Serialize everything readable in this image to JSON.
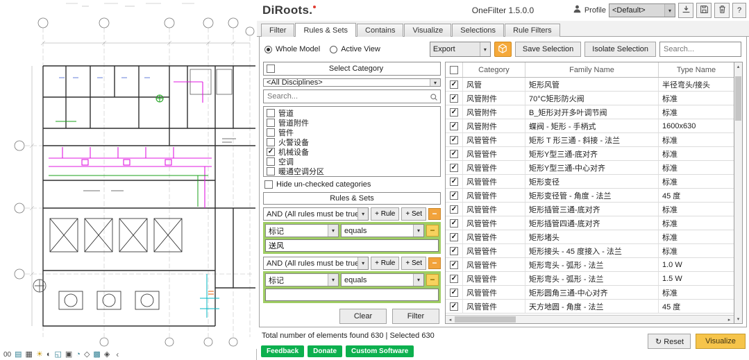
{
  "window": {
    "logo": "DiRoots.",
    "title": "OneFilter 1.5.0.0",
    "profile": {
      "label": "Profile",
      "value": "<Default>"
    },
    "help_label": "?"
  },
  "tabs": [
    {
      "label": "Filter",
      "active": false
    },
    {
      "label": "Rules & Sets",
      "active": true
    },
    {
      "label": "Contains",
      "active": false
    },
    {
      "label": "Visualize",
      "active": false
    },
    {
      "label": "Selections",
      "active": false
    },
    {
      "label": "Rule Filters",
      "active": false
    }
  ],
  "scope": {
    "whole_model": {
      "label": "Whole Model",
      "selected": true
    },
    "active_view": {
      "label": "Active View",
      "selected": false
    }
  },
  "actions": {
    "export_label": "Export",
    "save_selection_label": "Save Selection",
    "isolate_selection_label": "Isolate Selection",
    "search_placeholder": "Search..."
  },
  "category_panel": {
    "header_label": "Select Category",
    "disciplines_value": "<All Disciplines>",
    "search_placeholder": "Search...",
    "categories": [
      {
        "label": "管道",
        "checked": false
      },
      {
        "label": "管道附件",
        "checked": false
      },
      {
        "label": "管件",
        "checked": false
      },
      {
        "label": "火警设备",
        "checked": false
      },
      {
        "label": "机械设备",
        "checked": true
      },
      {
        "label": "空调",
        "checked": false
      },
      {
        "label": "暖通空调分区",
        "checked": false
      }
    ],
    "hide_unchecked_label": "Hide un-checked categories"
  },
  "rules_panel": {
    "header_label": "Rules & Sets",
    "add_rule_label": "+ Rule",
    "add_set_label": "+ Set",
    "remove_label": "−",
    "groups": [
      {
        "logic": "AND (All rules must be true)",
        "parameter": "标记",
        "operator": "equals",
        "value": "送风"
      },
      {
        "logic": "AND (All rules must be true)",
        "parameter": "标记",
        "operator": "equals",
        "value": ""
      }
    ],
    "clear_label": "Clear",
    "filter_label": "Filter"
  },
  "results_table": {
    "columns": [
      "Category",
      "Family Name",
      "Type Name"
    ],
    "rows": [
      {
        "checked": true,
        "category": "风管",
        "family": "矩形风管",
        "type": "半径弯头/接头"
      },
      {
        "checked": true,
        "category": "风管附件",
        "family": "70°C矩形防火阀",
        "type": "标准"
      },
      {
        "checked": true,
        "category": "风管附件",
        "family": "B_矩形对开多叶调节阀",
        "type": "标准"
      },
      {
        "checked": true,
        "category": "风管附件",
        "family": "蝶阀 - 矩形 - 手柄式",
        "type": "1600x630"
      },
      {
        "checked": true,
        "category": "风管管件",
        "family": "矩形 T 形三通 - 斜接 - 法兰",
        "type": "标准"
      },
      {
        "checked": true,
        "category": "风管管件",
        "family": "矩形Y型三通-底对齐",
        "type": "标准"
      },
      {
        "checked": true,
        "category": "风管管件",
        "family": "矩形Y型三通-中心对齐",
        "type": "标准"
      },
      {
        "checked": true,
        "category": "风管管件",
        "family": "矩形变径",
        "type": "标准"
      },
      {
        "checked": true,
        "category": "风管管件",
        "family": "矩形变径管 - 角度 - 法兰",
        "type": "45 度"
      },
      {
        "checked": true,
        "category": "风管管件",
        "family": "矩形插管三通-底对齐",
        "type": "标准"
      },
      {
        "checked": true,
        "category": "风管管件",
        "family": "矩形插管四通-底对齐",
        "type": "标准"
      },
      {
        "checked": true,
        "category": "风管管件",
        "family": "矩形堵头",
        "type": "标准"
      },
      {
        "checked": true,
        "category": "风管管件",
        "family": "矩形接头 - 45 度接入 - 法兰",
        "type": "标准"
      },
      {
        "checked": true,
        "category": "风管管件",
        "family": "矩形弯头 - 弧形 - 法兰",
        "type": "1.0 W"
      },
      {
        "checked": true,
        "category": "风管管件",
        "family": "矩形弯头 - 弧形 - 法兰",
        "type": "1.5 W"
      },
      {
        "checked": true,
        "category": "风管管件",
        "family": "矩形圆角三通-中心对齐",
        "type": "标准"
      },
      {
        "checked": true,
        "category": "风管管件",
        "family": "天方地圆 - 角度 - 法兰",
        "type": "45 度"
      }
    ]
  },
  "status_bar": {
    "summary": "Total number of elements found 630 | Selected 630"
  },
  "footer": {
    "reset_icon": "↻",
    "reset_label": "Reset",
    "visualize_label": "Visualize",
    "links": [
      {
        "label": "Feedback"
      },
      {
        "label": "Donate"
      },
      {
        "label": "Custom Software"
      }
    ]
  },
  "revit_view": {
    "scale_text": "00",
    "icons": [
      {
        "name": "detail-level",
        "glyph": "▤"
      },
      {
        "name": "visual-style",
        "glyph": "▦"
      },
      {
        "name": "sun-path",
        "glyph": "☀"
      },
      {
        "name": "shadows",
        "glyph": "◐"
      },
      {
        "name": "crop-view",
        "glyph": "◱"
      },
      {
        "name": "show-crop-region",
        "glyph": "▣"
      },
      {
        "name": "temporary-hide-isolate",
        "glyph": "◔"
      },
      {
        "name": "reveal-hidden-elements",
        "glyph": "◇"
      },
      {
        "name": "temporary-view-properties",
        "glyph": "▩"
      },
      {
        "name": "analytical-model",
        "glyph": "◈"
      }
    ],
    "collapse_glyph": "‹"
  },
  "glyphs": {
    "chevron_down": "▾",
    "scroll_up": "▴",
    "scroll_down": "▾",
    "scroll_left": "◂",
    "scroll_right": "▸"
  },
  "colors": {
    "accent_green": "#0cb04e",
    "accent_yellow": "#f6c44a",
    "accent_orange": "#f2a33c",
    "rule_group_green": "#9fcd63"
  }
}
